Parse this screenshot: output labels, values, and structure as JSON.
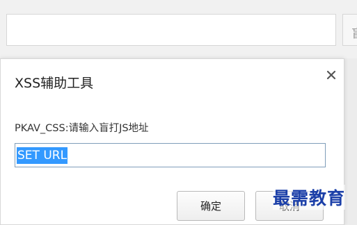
{
  "background": {
    "side_button_label": "盲"
  },
  "dialog": {
    "title": "XSS辅助工具",
    "close_symbol": "×",
    "prompt": "PKAV_CSS:请输入盲打JS地址",
    "input_value": "SET URL",
    "ok_label": "确定",
    "cancel_label": "取消"
  },
  "watermark": "最需教育",
  "colors": {
    "selection": "#3399ff",
    "watermark": "#1b3fa8",
    "input_border": "#7f9db9"
  }
}
